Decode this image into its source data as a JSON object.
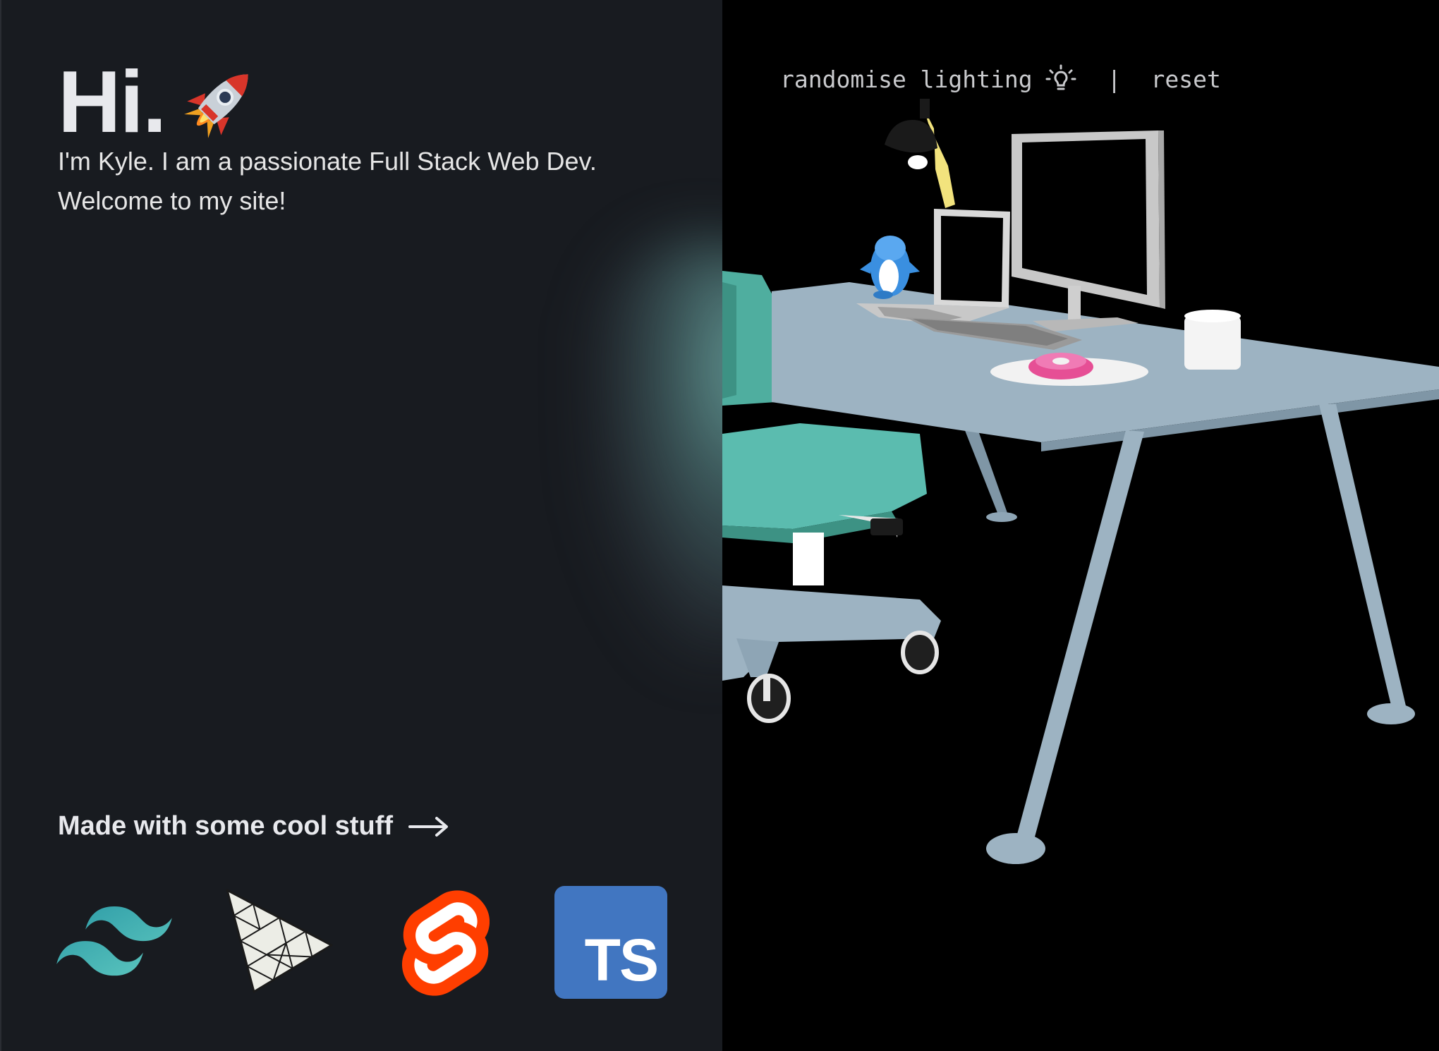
{
  "hero": {
    "greeting": "Hi.",
    "intro_line1": "I'm Kyle. I am a passionate Full Stack Web Dev.",
    "intro_line2": "Welcome to my site!"
  },
  "tech": {
    "heading": "Made with some cool stuff",
    "logos": [
      "tailwind-css",
      "three-js",
      "svelte",
      "typescript"
    ],
    "ts_label": "TS"
  },
  "scene_controls": {
    "randomise_label": "randomise lighting",
    "separator": "|",
    "reset_label": "reset"
  },
  "colors": {
    "left_bg": "#181b20",
    "right_bg": "#000000",
    "tailwind": "#38bdf8",
    "svelte": "#ff3e00",
    "typescript": "#4176c1",
    "chair": "#5bbcaf",
    "desk": "#9db3c2"
  }
}
